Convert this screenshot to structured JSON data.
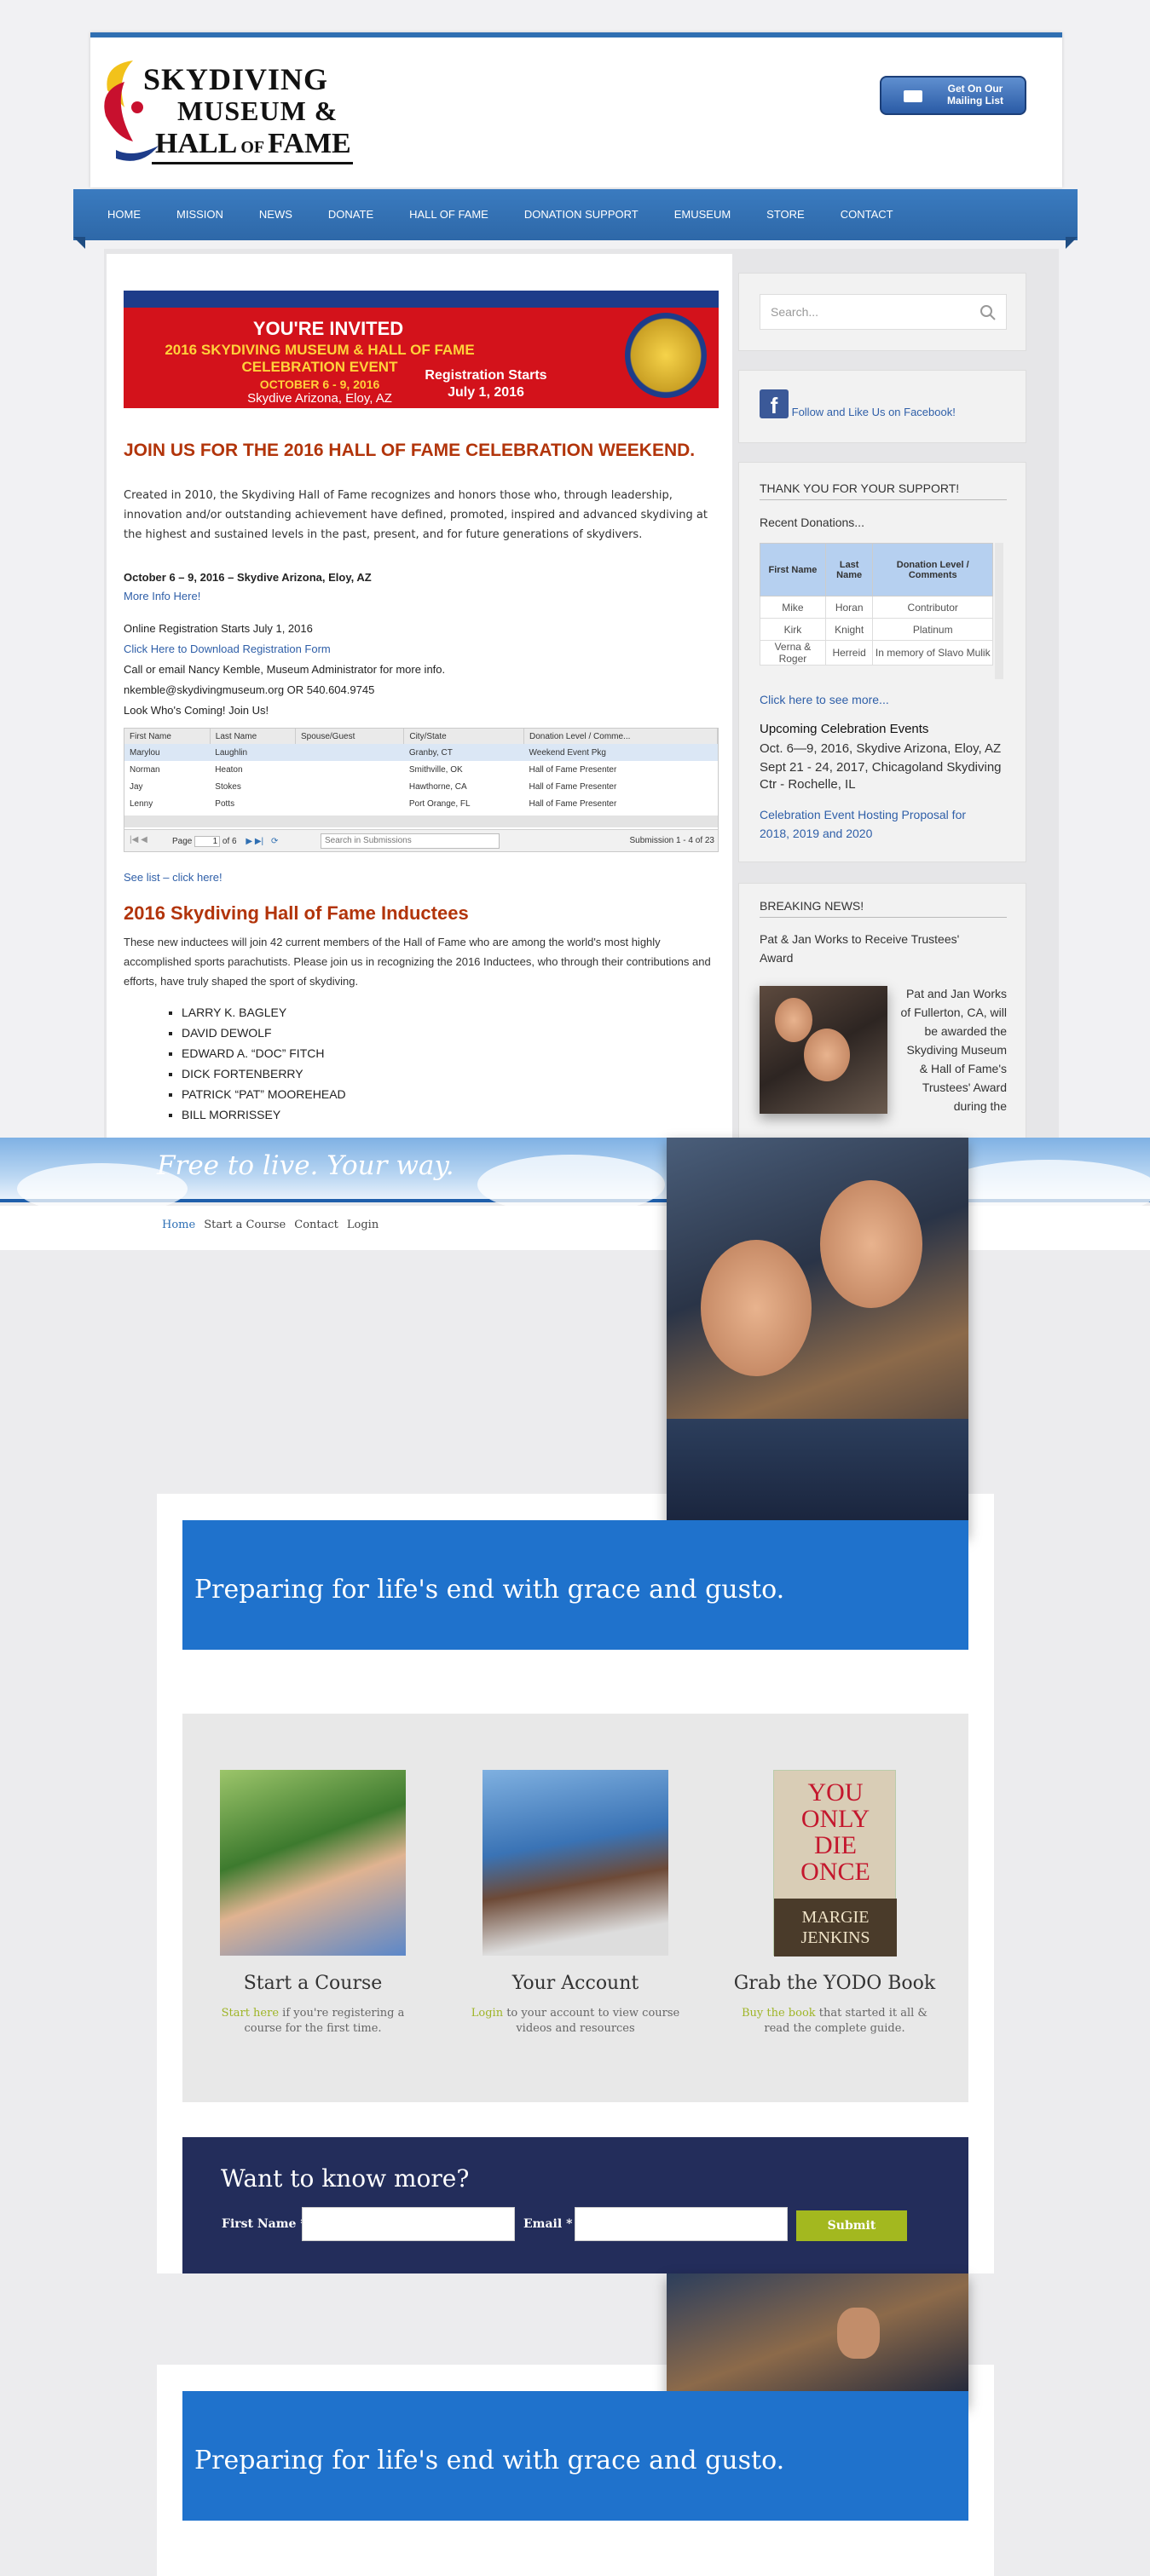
{
  "sky": {
    "logo": {
      "line1": "SKYDIVING",
      "line2": "MUSEUM &",
      "line3": "HALL",
      "line3b": "OF",
      "line3c": "FAME"
    },
    "mailing_button": "Get On Our Mailing List",
    "nav": [
      "HOME",
      "MISSION",
      "NEWS",
      "DONATE",
      "HALL OF FAME",
      "DONATION SUPPORT",
      "EMUSEUM",
      "STORE",
      "CONTACT"
    ],
    "banner": {
      "invited": "YOU'RE INVITED",
      "event": "2016 SKYDIVING MUSEUM & HALL OF FAME CELEBRATION EVENT",
      "dates": "OCTOBER 6 - 9, 2016",
      "location": "Skydive Arizona, Eloy, AZ",
      "registration": "Registration Starts July 1, 2016"
    },
    "heading": "JOIN US FOR THE 2016 HALL OF FAME CELEBRATION WEEKEND.",
    "intro": "Created in 2010, the Skydiving Hall of Fame recognizes and honors those who, through leadership, innovation and/or outstanding achievement have defined, promoted, inspired and advanced skydiving at the highest and sustained levels in the past, present, and for future generations of skydivers.",
    "event_dates": "October 6 – 9, 2016 – Skydive Arizona, Eloy, AZ",
    "more_info": "More Info Here!",
    "registration_line": "Online Registration Starts July 1, 2016",
    "download_link": "Click Here to Download Registration Form",
    "contact_line": "Call or email Nancy Kemble, Museum Administrator for more info.",
    "contact_email": "nkemble@skydivingmuseum.org OR 540.604.9745",
    "whos_coming": "Look Who's Coming! Join Us!",
    "grid": {
      "columns": [
        "First Name",
        "Last Name",
        "Spouse/Guest",
        "City/State",
        "Donation Level / Comme..."
      ],
      "rows": [
        [
          "Marylou",
          "Laughlin",
          "",
          "Granby, CT",
          "Weekend Event Pkg"
        ],
        [
          "Norman",
          "Heaton",
          "",
          "Smithville, OK",
          "Hall of Fame Presenter"
        ],
        [
          "Jay",
          "Stokes",
          "",
          "Hawthorne, CA",
          "Hall of Fame Presenter"
        ],
        [
          "Lenny",
          "Potts",
          "",
          "Port Orange, FL",
          "Hall of Fame Presenter"
        ]
      ],
      "page_label": "Page",
      "page_value": "1",
      "page_of": "of 6",
      "search_placeholder": "Search in Submissions",
      "count": "Submission 1 - 4 of 23"
    },
    "see_list": "See list – click here!",
    "inductees_heading": "2016 Skydiving Hall of Fame Inductees",
    "inductees_text": "These new inductees will join 42 current members of the Hall of Fame who are among the world's most highly accomplished sports parachutists. Please join us in recognizing the 2016 Inductees, who through their contributions and efforts, have truly shaped the sport of skydiving.",
    "inductees": [
      "LARRY K. BAGLEY",
      "DAVID DEWOLF",
      "EDWARD A. “DOC” FITCH",
      "DICK FORTENBERRY",
      "PATRICK “PAT” MOOREHEAD",
      "BILL MORRISSEY"
    ],
    "sidebar": {
      "search_placeholder": "Search...",
      "facebook": "Follow and Like Us on Facebook!",
      "thanks_title": "THANK YOU FOR YOUR SUPPORT!",
      "recent": "Recent Donations...",
      "don_cols": [
        "First Name",
        "Last Name",
        "Donation Level / Comments"
      ],
      "donations": [
        [
          "Mike",
          "Horan",
          "Contributor"
        ],
        [
          "Kirk",
          "Knight",
          "Platinum"
        ],
        [
          "Verna & Roger",
          "Herreid",
          "In memory of Slavo Mulik"
        ]
      ],
      "see_more": "Click here to see more...",
      "upcoming": "Upcoming Celebration Events",
      "upcoming_1": "Oct. 6—9, 2016, Skydive Arizona, Eloy, AZ",
      "upcoming_2": "Sept 21 - 24, 2017, Chicagoland Skydiving Ctr - Rochelle, IL",
      "proposal": "Celebration Event Hosting Proposal for 2018, 2019 and 2020",
      "news_title": "BREAKING NEWS!",
      "news_head": "Pat & Jan Works to Receive Trustees' Award",
      "news_body": "Pat and Jan Works of Fullerton, CA, will be awarded the Skydiving Museum & Hall of Fame's Trustees' Award during the"
    }
  },
  "ftl": {
    "tagline": "Free to live. Your way.",
    "nav": [
      "Home",
      "Start a Course",
      "Contact",
      "Login"
    ],
    "banner": "Preparing for life's end with grace and gusto.",
    "tiles": [
      {
        "title": "Start a Course",
        "link": "Start here",
        "desc": " if you're registering a course for the first time."
      },
      {
        "title": "Your Account",
        "link": "Login",
        "desc": " to your account to view course videos and resources"
      },
      {
        "title": "Grab the YODO Book",
        "link": "Buy the book",
        "desc": " that started it all & read the complete guide."
      }
    ],
    "book": {
      "title_1": "YOU",
      "title_2": "ONLY",
      "title_3": "DIE",
      "title_4": "ONCE",
      "author_1": "MARGIE",
      "author_2": "JENKINS"
    },
    "form": {
      "heading": "Want to know more?",
      "first_name": "First Name *",
      "email": "Email *",
      "submit": "Submit"
    },
    "banner_2": "Preparing for life's end with grace and gusto."
  },
  "colors": {
    "nav_blue": "#2e68a8",
    "heading_red": "#b2340a",
    "ftl_blue": "#1f72cc",
    "form_navy": "#232d5b",
    "submit_green": "#a3b81f"
  }
}
